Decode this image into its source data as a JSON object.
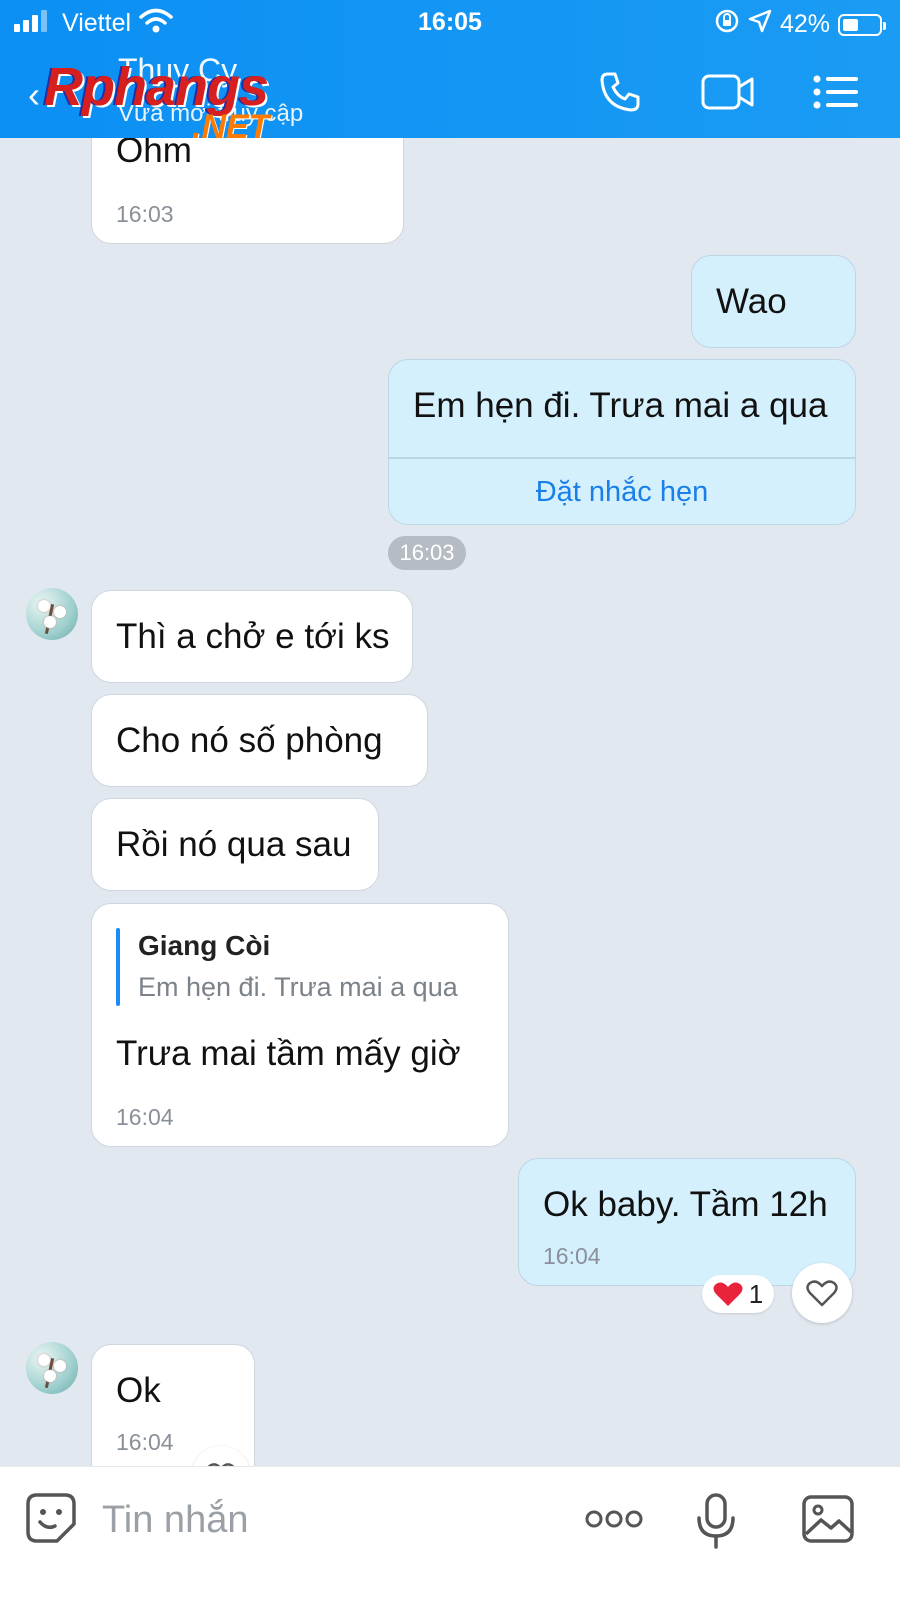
{
  "status_bar": {
    "carrier": "Viettel",
    "time": "16:05",
    "battery": "42%",
    "battery_level": 0.42
  },
  "header": {
    "contact_name": "Thuy Cy",
    "contact_status": "Vừa mới truy cập",
    "watermark_word": "Rphangs",
    "watermark_net": ".NET",
    "icons": [
      "back-icon",
      "phone-icon",
      "video-call-icon",
      "menu-list-icon"
    ]
  },
  "messages": [
    {
      "direction": "in",
      "text": "Ohm",
      "time": "16:03"
    },
    {
      "direction": "out",
      "text": "Wao"
    },
    {
      "direction": "out",
      "text": "Em hẹn đi. Trưa mai a qua",
      "action": "Đặt nhắc hẹn"
    },
    {
      "separator_time": "16:03"
    },
    {
      "direction": "in",
      "text": "Thì a chở e tới ks"
    },
    {
      "direction": "in",
      "text": "Cho nó số phòng"
    },
    {
      "direction": "in",
      "text": "Rồi nó qua sau"
    },
    {
      "direction": "in",
      "quote_name": "Giang Còi",
      "quote_text": "Em hẹn đi. Trưa mai a qua",
      "text": "Trưa mai tầm mấy giờ",
      "time": "16:04"
    },
    {
      "direction": "out",
      "text": "Ok baby. Tầm 12h",
      "time": "16:04",
      "reaction": "❤",
      "reaction_count": "1"
    },
    {
      "direction": "in",
      "text": "Ok",
      "time": "16:04"
    }
  ],
  "input_bar": {
    "placeholder": "Tin nhắn",
    "icons": [
      "sticker-icon",
      "more-icon",
      "microphone-icon",
      "image-icon"
    ]
  },
  "colors": {
    "header": "#0b8ff3",
    "background": "#e2e8f0",
    "outgoing_bubble": "#d5f0fd",
    "incoming_bubble": "#ffffff",
    "link": "#1a7fe8",
    "reaction_heart": "#e8233a"
  }
}
